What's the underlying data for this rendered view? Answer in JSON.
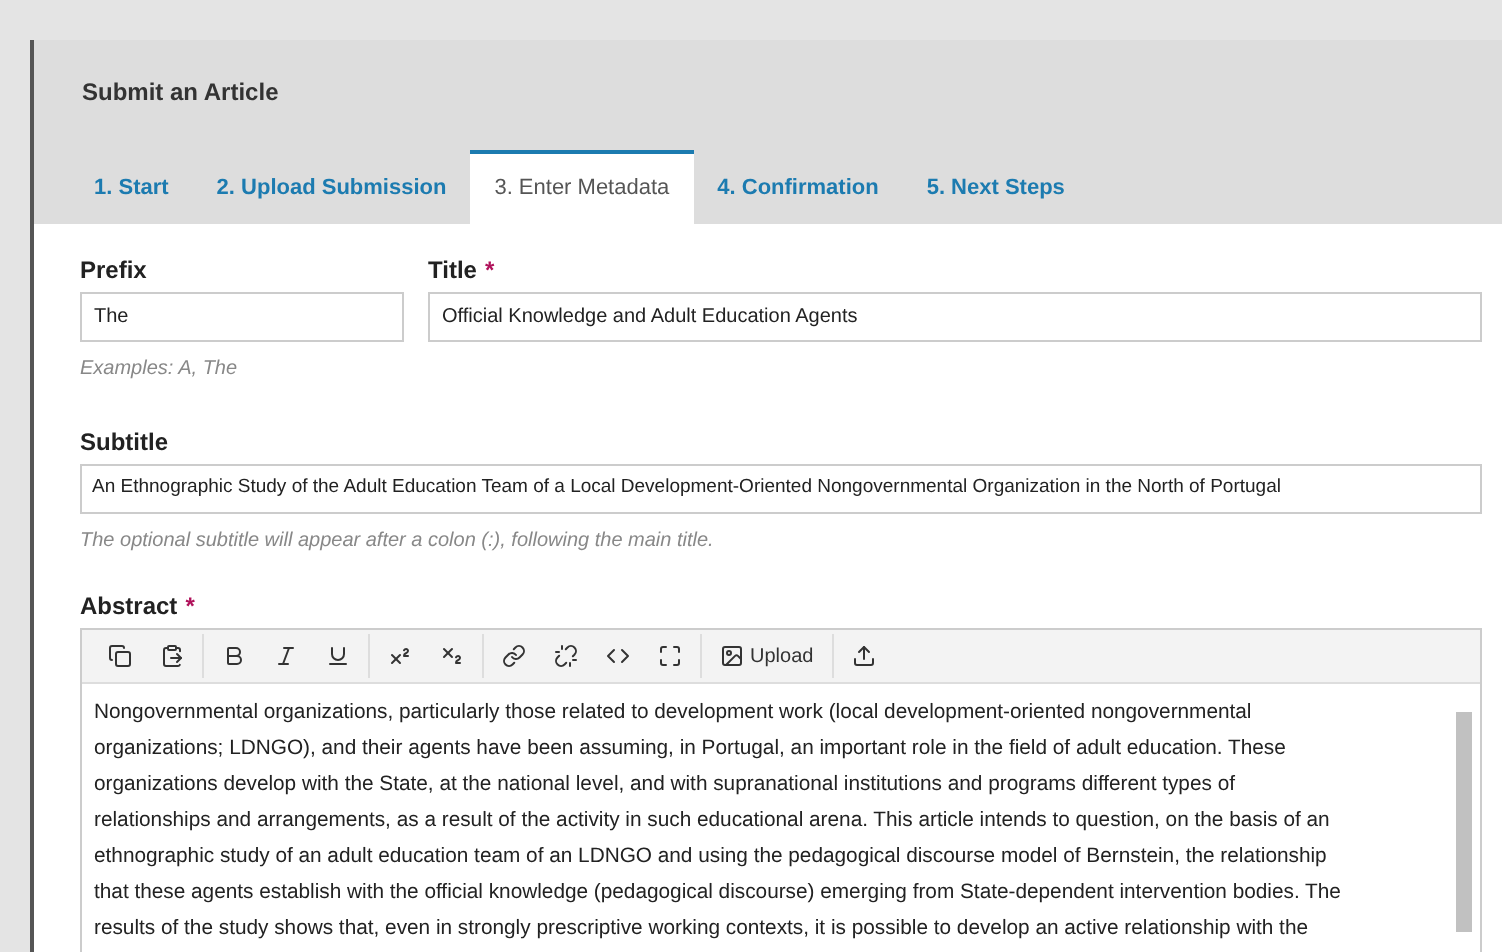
{
  "page_title": "Submit an Article",
  "tabs": [
    {
      "label": "1. Start",
      "selected": false
    },
    {
      "label": "2. Upload Submission",
      "selected": false
    },
    {
      "label": "3. Enter Metadata",
      "selected": true
    },
    {
      "label": "4. Confirmation",
      "selected": false
    },
    {
      "label": "5. Next Steps",
      "selected": false
    }
  ],
  "prefix": {
    "label": "Prefix",
    "value": "The",
    "help": "Examples: A, The"
  },
  "title": {
    "label": "Title",
    "required_mark": "*",
    "value": "Official Knowledge and Adult Education Agents"
  },
  "subtitle": {
    "label": "Subtitle",
    "value": "An Ethnographic Study of the Adult Education Team of a Local Development-Oriented Nongovernmental Organization in the North of Portugal",
    "help": "The optional subtitle will appear after a colon (:), following the main title."
  },
  "abstract": {
    "label": "Abstract",
    "required_mark": "*",
    "toolbar": [
      {
        "kind": "copy"
      },
      {
        "kind": "paste"
      },
      {
        "kind": "bold"
      },
      {
        "kind": "italic"
      },
      {
        "kind": "underline"
      },
      {
        "kind": "superscript"
      },
      {
        "kind": "subscript"
      },
      {
        "kind": "link"
      },
      {
        "kind": "unlink"
      },
      {
        "kind": "code"
      },
      {
        "kind": "fullscreen"
      },
      {
        "kind": "image",
        "label": "Upload"
      },
      {
        "kind": "upload"
      }
    ],
    "lines": [
      "Nongovernmental organizations, particularly those related to development work (local development-oriented nongovernmental",
      "organizations; LDNGO), and their agents have been assuming, in Portugal, an important role in the field of adult education. These",
      "organizations develop with the State, at the national level, and with supranational institutions and programs different types of",
      "relationships and arrangements, as a result of the activity in such educational arena. This article intends to question, on the basis of an",
      "ethnographic study of an adult education team of an LDNGO and using the pedagogical discourse model of Bernstein, the relationship",
      "that these agents establish with the official knowledge (pedagogical discourse) emerging from State-dependent intervention bodies. The",
      "results of the study shows that, even in strongly prescriptive working contexts, it is possible to develop an active relationship with the"
    ]
  }
}
